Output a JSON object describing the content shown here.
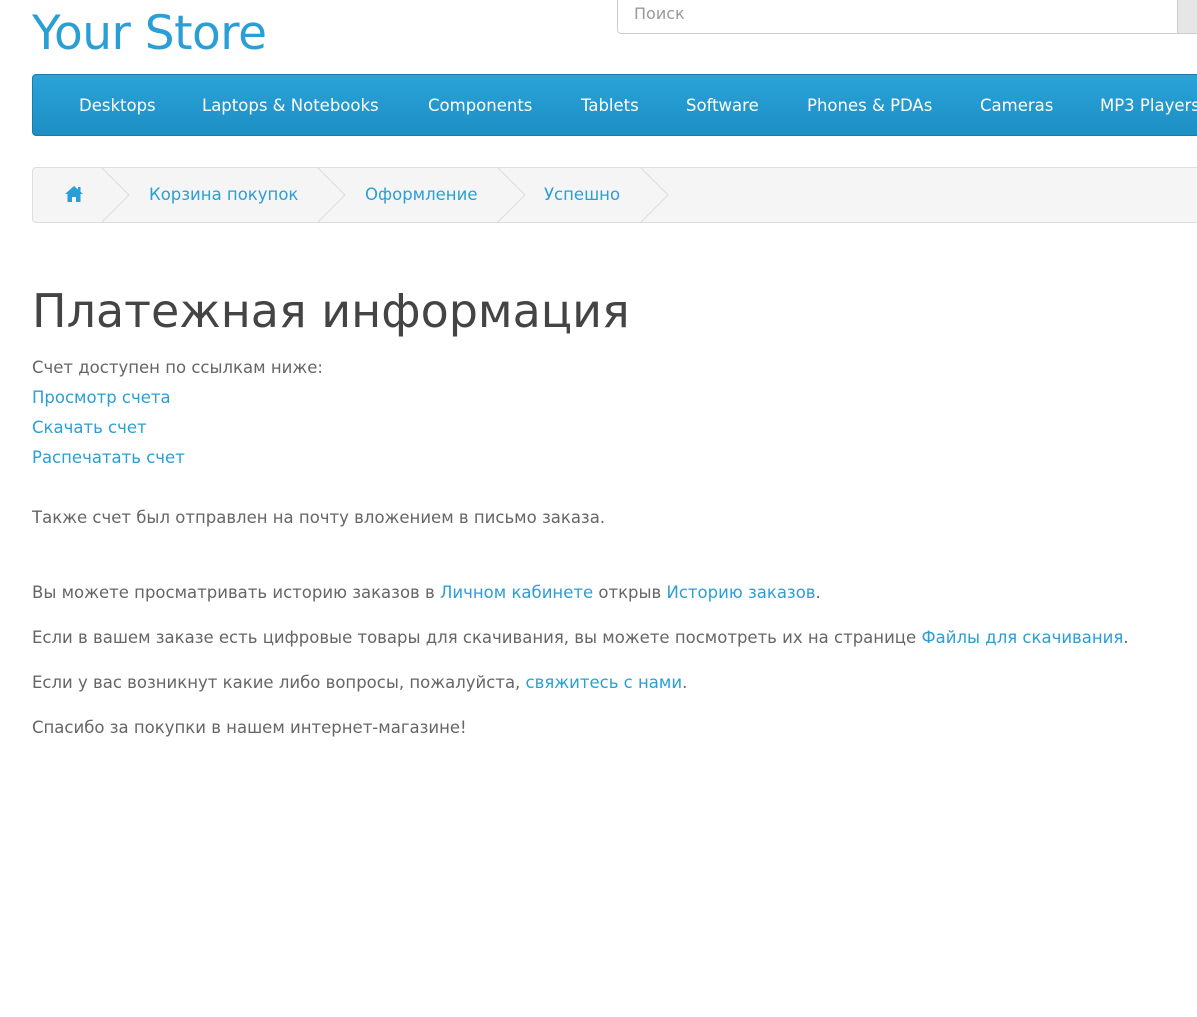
{
  "header": {
    "logo": "Your Store",
    "search_placeholder": "Поиск"
  },
  "menu": {
    "items": [
      "Desktops",
      "Laptops & Notebooks",
      "Components",
      "Tablets",
      "Software",
      "Phones & PDAs",
      "Cameras",
      "MP3 Players"
    ]
  },
  "breadcrumb": {
    "home_icon": "home-icon",
    "items": [
      "Корзина покупок",
      "Оформление",
      "Успешно"
    ]
  },
  "content": {
    "title": "Платежная информация",
    "invoice_intro": "Счет доступен по ссылкам ниже:",
    "invoice_links": [
      "Просмотр счета",
      "Скачать счет",
      "Распечатать счет"
    ],
    "email_note": "Также счет был отправлен на почту вложением в письмо заказа.",
    "history": {
      "text1": "Вы можете просматривать историю заказов в ",
      "link1": "Личном кабинете",
      "text2": " открыв ",
      "link2": "Историю заказов",
      "text3": "."
    },
    "downloads": {
      "text1": "Если в вашем заказе есть цифровые товары для скачивания, вы можете посмотреть их на странице ",
      "link": "Файлы для скачивания",
      "text2": "."
    },
    "contact": {
      "text1": "Если у вас возникнут какие либо вопросы, пожалуйста, ",
      "link": "свяжитесь с нами",
      "text2": "."
    },
    "thanks": "Спасибо за покупки в нашем интернет-магазине!"
  },
  "colors": {
    "accent": "#2a9fd6",
    "menu_bg": "#229ad1",
    "text": "#666666",
    "title": "#444444"
  }
}
